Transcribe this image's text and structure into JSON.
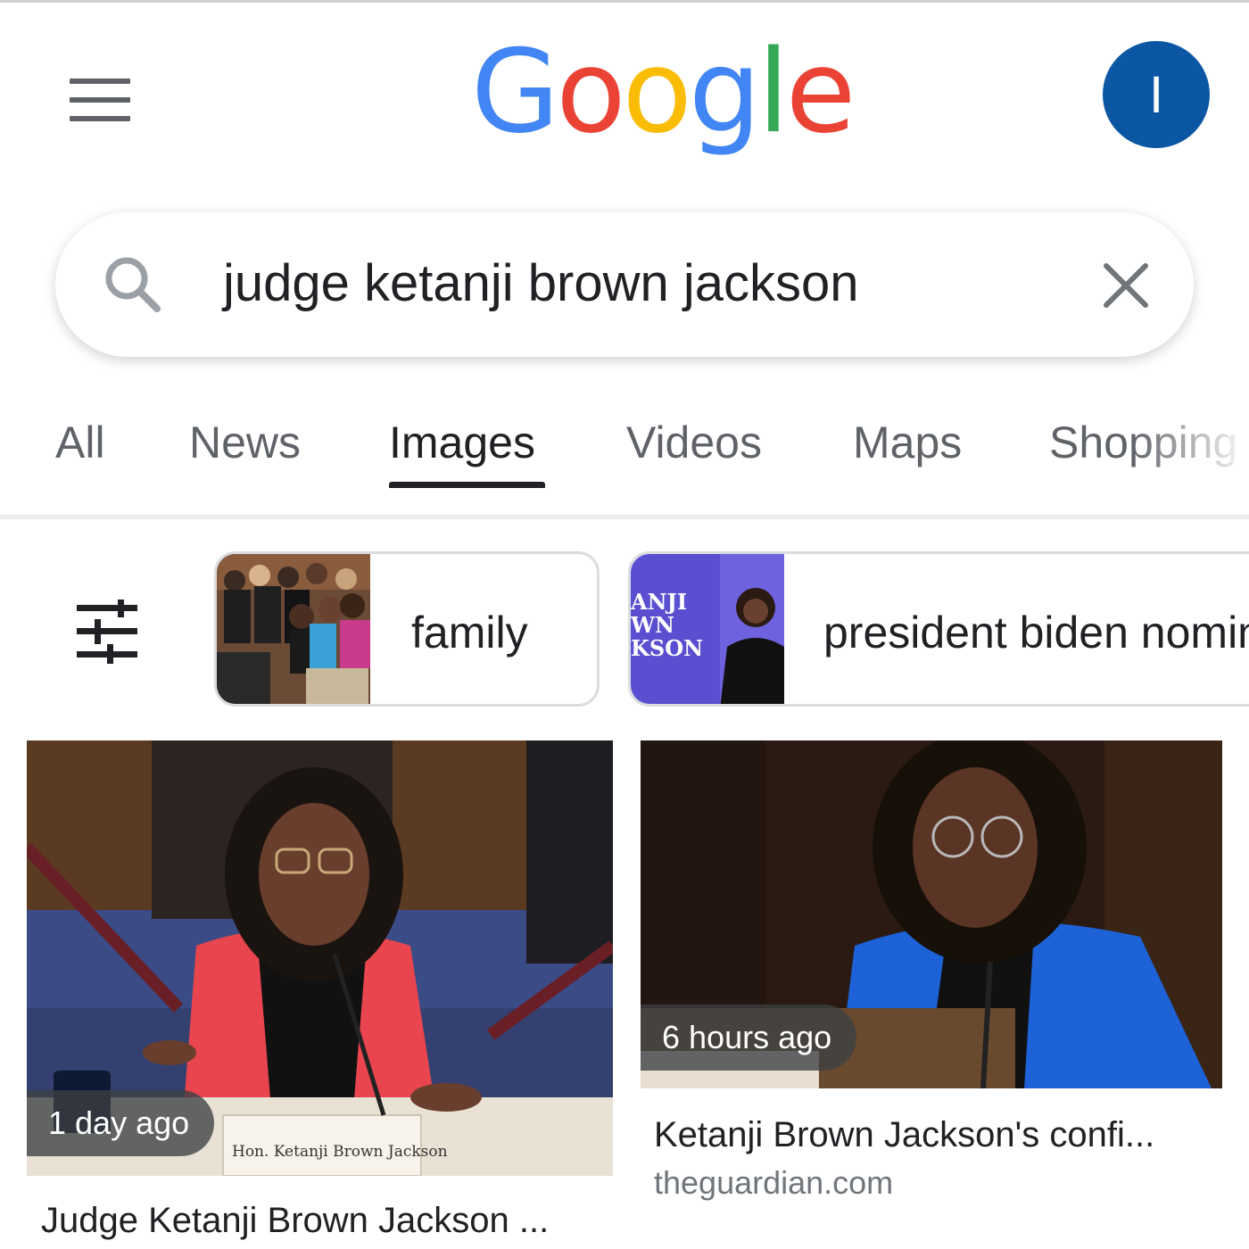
{
  "header": {
    "logo_text": "Google",
    "avatar_initial": "I",
    "avatar_color": "#0b57a4"
  },
  "search": {
    "query": "judge ketanji brown jackson"
  },
  "tabs": [
    {
      "label": "All"
    },
    {
      "label": "News"
    },
    {
      "label": "Images",
      "active": true
    },
    {
      "label": "Videos"
    },
    {
      "label": "Maps"
    },
    {
      "label": "Shopping"
    }
  ],
  "chips": [
    {
      "label": "family"
    },
    {
      "label": "president biden nominates",
      "thumb_text": "ANJI WN KSON"
    }
  ],
  "results": [
    {
      "age": "1 day ago",
      "title": "Judge Ketanji Brown Jackson ...",
      "nameplate": "Hon. Ketanji Brown Jackson"
    },
    {
      "age": "6 hours ago",
      "title": "Ketanji Brown Jackson's confi...",
      "source": "theguardian.com"
    }
  ],
  "icons": [
    "menu-icon",
    "search-icon",
    "close-icon",
    "filter-icon"
  ]
}
